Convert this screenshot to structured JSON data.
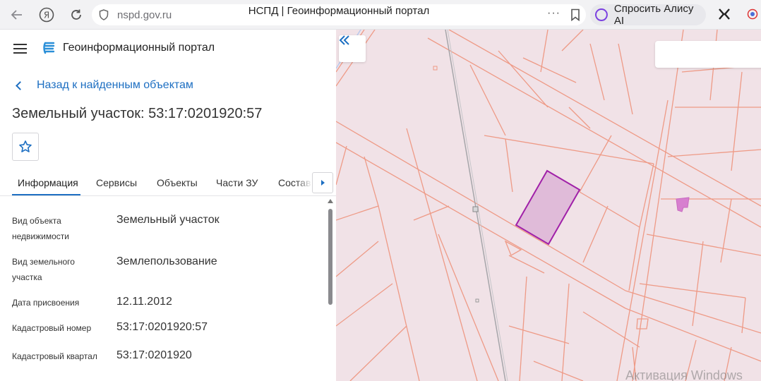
{
  "browser": {
    "url": "nspd.gov.ru",
    "tab_title": "НСПД | Геоинформационный портал",
    "alice_label": "Спросить Алису AI",
    "dots": "···"
  },
  "header": {
    "portal_title": "Геоинформационный портал"
  },
  "back_link": "Назад к найденным объектам",
  "object_title": "Земельный участок: 53:17:0201920:57",
  "tabs": [
    {
      "label": "Информация",
      "active": true
    },
    {
      "label": "Сервисы",
      "active": false
    },
    {
      "label": "Объекты",
      "active": false
    },
    {
      "label": "Части ЗУ",
      "active": false
    },
    {
      "label": "Состав",
      "active": false
    }
  ],
  "attributes": [
    {
      "label": "Вид объекта недвижимости",
      "value": "Земельный участок"
    },
    {
      "label": "Вид земельного участка",
      "value": "Землепользование"
    },
    {
      "label": "Дата присвоения",
      "value": "12.11.2012"
    },
    {
      "label": "Кадастровый номер",
      "value": "53:17:0201920:57"
    },
    {
      "label": "Кадастровый квартал",
      "value": "53:17:0201920"
    }
  ],
  "watermark": "Активация Windows",
  "colors": {
    "accent": "#1d6fc2",
    "map_bg": "#f1e2e7",
    "parcel_line": "#ee9a86",
    "selected_fill": "#e0bbd9",
    "selected_stroke": "#a020a8"
  }
}
